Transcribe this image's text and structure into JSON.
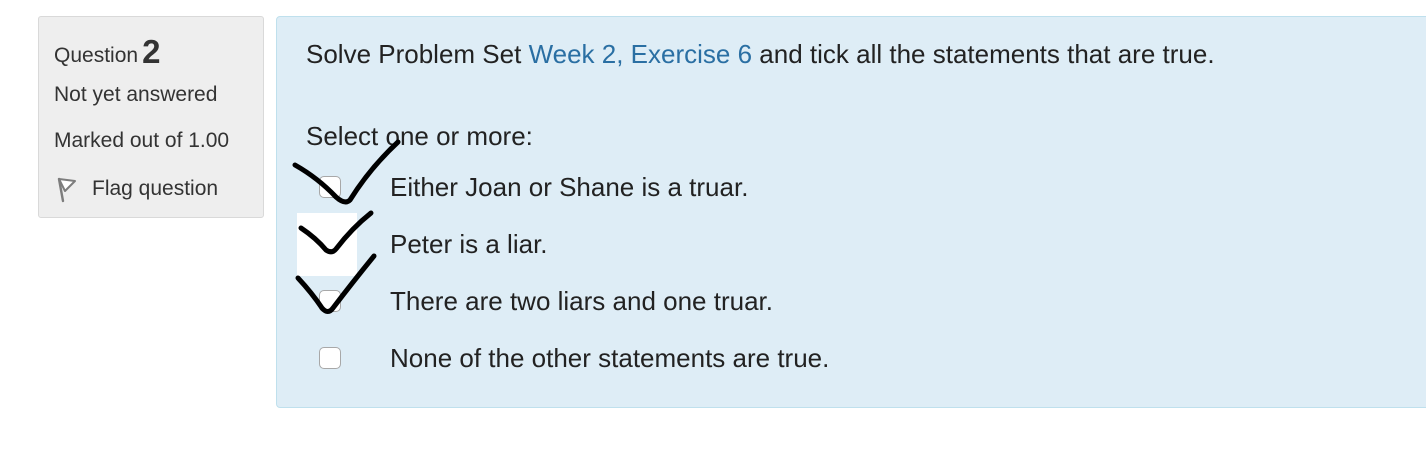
{
  "info": {
    "question_label": "Question",
    "question_number": "2",
    "state": "Not yet answered",
    "grade": "Marked out of 1.00",
    "flag_label": "Flag question"
  },
  "question": {
    "text_before": "Solve Problem Set ",
    "link_text": "Week 2, Exercise 6",
    "text_after": " and tick all the statements that are true.",
    "prompt": "Select one or more:",
    "options": [
      {
        "label": "Either Joan or Shane is a truar.",
        "hand_ticked": true
      },
      {
        "label": "Peter is a liar.",
        "hand_ticked": true
      },
      {
        "label": "There are two liars and one truar.",
        "hand_ticked": true
      },
      {
        "label": "None of the other statements are true.",
        "hand_ticked": false
      }
    ]
  },
  "colors": {
    "panel_bg": "#deedf6",
    "info_bg": "#eeeeee",
    "link": "#2a6fa3",
    "tick_ink": "#000000"
  }
}
